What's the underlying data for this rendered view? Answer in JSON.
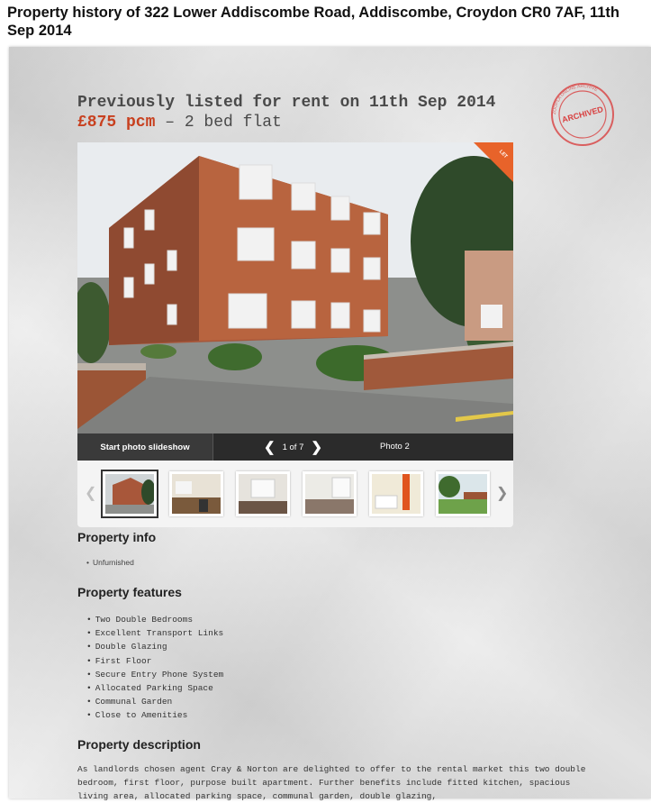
{
  "page_title": "Property history of 322 Lower Addiscombe Road, Addiscombe, Croydon CR0 7AF, 11th Sep 2014",
  "listing": {
    "headline": "Previously listed for rent on 11th Sep 2014",
    "price": "£875 pcm",
    "summary": " – 2 bed flat"
  },
  "stamp": {
    "text": "ARCHIVED",
    "ring_text": "ZOOPLA ONLINE ARCHIVE",
    "color": "#d84040"
  },
  "photo": {
    "ribbon": "LET",
    "ribbon_color": "#e8632a"
  },
  "photo_bar": {
    "slideshow_label": "Start photo slideshow",
    "prev_icon": "chevron-left-icon",
    "next_icon": "chevron-right-icon",
    "counter": "1 of 7",
    "photo_label": "Photo 2"
  },
  "thumbnails": [
    {
      "name": "thumb-exterior",
      "active": true
    },
    {
      "name": "thumb-kitchen"
    },
    {
      "name": "thumb-living-room"
    },
    {
      "name": "thumb-bedroom"
    },
    {
      "name": "thumb-bathroom"
    },
    {
      "name": "thumb-garden"
    }
  ],
  "property_info": {
    "heading": "Property info",
    "items": [
      "Unfurnished"
    ]
  },
  "property_features": {
    "heading": "Property features",
    "items": [
      "Two Double Bedrooms",
      "Excellent Transport Links",
      "Double Glazing",
      "First Floor",
      "Secure Entry Phone System",
      "Allocated Parking Space",
      "Communal Garden",
      "Close to Amenities"
    ]
  },
  "property_description": {
    "heading": "Property description",
    "text": "As landlords chosen agent Cray & Norton are delighted to offer to the rental market this two double bedroom, first floor, purpose built apartment. Further benefits include fitted kitchen, spacious living area, allocated parking space, communal garden, double glazing,"
  },
  "colors": {
    "price": "#c8401f",
    "bar": "#2b2b2b"
  }
}
